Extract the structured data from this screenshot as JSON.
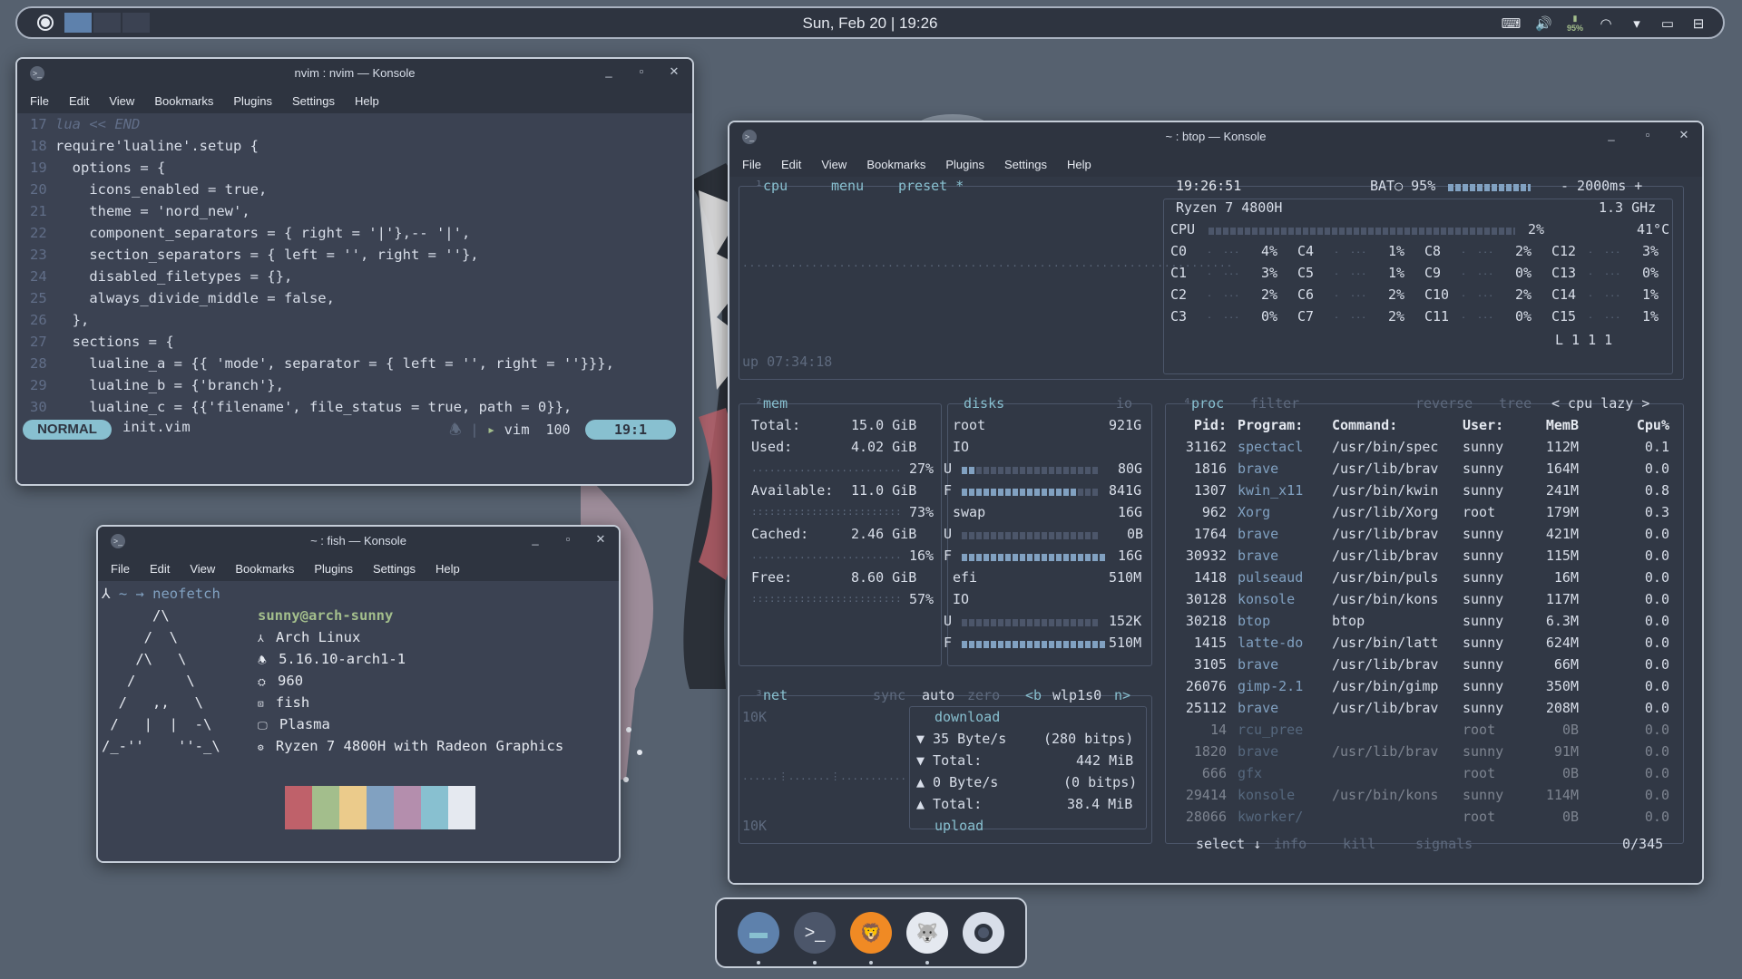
{
  "panel": {
    "datetime": "Sun, Feb 20 | 19:26",
    "battery": "95%",
    "icons": [
      "keyboard-icon",
      "volume-icon",
      "battery-icon",
      "wifi-icon",
      "chevron-down-icon",
      "display-icon",
      "window-icon"
    ]
  },
  "nvim": {
    "title": "nvim : nvim — Konsole",
    "menu": [
      "File",
      "Edit",
      "View",
      "Bookmarks",
      "Plugins",
      "Settings",
      "Help"
    ],
    "lines": [
      {
        "n": "17",
        "text": "lua << END"
      },
      {
        "n": "18",
        "text": "require'lualine'.setup {"
      },
      {
        "n": "19",
        "text": "  options = {"
      },
      {
        "n": "20",
        "text": "    icons_enabled = true,"
      },
      {
        "n": "21",
        "text": "    theme = 'nord_new',"
      },
      {
        "n": "22",
        "text": "    component_separators = { right = '|'},-- '|',"
      },
      {
        "n": "23",
        "text": "    section_separators = { left = '', right = ''},"
      },
      {
        "n": "24",
        "text": "    disabled_filetypes = {},"
      },
      {
        "n": "25",
        "text": "    always_divide_middle = false,"
      },
      {
        "n": "26",
        "text": "  },"
      },
      {
        "n": "27",
        "text": "  sections = {"
      },
      {
        "n": "28",
        "text": "    lualine_a = {{ 'mode', separator = { left = '', right = ''}}},"
      },
      {
        "n": "29",
        "text": "    lualine_b = {'branch'},"
      },
      {
        "n": "30",
        "text": "    lualine_c = {{'filename', file_status = true, path = 0}},"
      }
    ],
    "status": {
      "mode": "NORMAL",
      "file": "init.vim",
      "filetype": "vim",
      "percent": "100",
      "position": "19:1"
    }
  },
  "fish": {
    "title": "~ : fish — Konsole",
    "menu": [
      "File",
      "Edit",
      "View",
      "Bookmarks",
      "Plugins",
      "Settings",
      "Help"
    ],
    "prompt": "~ → neofetch",
    "user": "sunny@arch-sunny",
    "info": [
      "Arch Linux",
      "5.16.10-arch1-1",
      "960",
      "fish",
      "Plasma",
      "Ryzen 7 4800H with Radeon Graphics"
    ],
    "art": [
      "      /\\",
      "     /  \\",
      "    /\\   \\",
      "   /      \\",
      "  /   ,,   \\",
      " /   |  |  -\\",
      "/_-''    ''-_\\"
    ],
    "colors": [
      "#3b4252",
      "#bf616a",
      "#a3be8c",
      "#ebcb8b",
      "#81a1c1",
      "#b48ead",
      "#88c0d0",
      "#e5e9f0"
    ]
  },
  "btop": {
    "title": "~ : btop — Konsole",
    "menu": [
      "File",
      "Edit",
      "View",
      "Bookmarks",
      "Plugins",
      "Settings",
      "Help"
    ],
    "header": {
      "cpu": "cpu",
      "menu": "menu",
      "preset": "preset *",
      "time": "19:26:51",
      "bat": "BAT○ 95%",
      "interval": "- 2000ms +"
    },
    "cpu": {
      "model": "Ryzen 7 4800H",
      "freq": "1.3 GHz",
      "total_label": "CPU",
      "total": "2%",
      "temp": "41°C",
      "cores": [
        {
          "c": "C0",
          "v": "4%"
        },
        {
          "c": "C4",
          "v": "1%"
        },
        {
          "c": "C8",
          "v": "2%"
        },
        {
          "c": "C12",
          "v": "3%"
        },
        {
          "c": "C1",
          "v": "3%"
        },
        {
          "c": "C5",
          "v": "1%"
        },
        {
          "c": "C9",
          "v": "0%"
        },
        {
          "c": "C13",
          "v": "0%"
        },
        {
          "c": "C2",
          "v": "2%"
        },
        {
          "c": "C6",
          "v": "2%"
        },
        {
          "c": "C10",
          "v": "2%"
        },
        {
          "c": "C14",
          "v": "1%"
        },
        {
          "c": "C3",
          "v": "0%"
        },
        {
          "c": "C7",
          "v": "2%"
        },
        {
          "c": "C11",
          "v": "0%"
        },
        {
          "c": "C15",
          "v": "1%"
        }
      ],
      "load": "L 1 1 1",
      "uptime": "up 07:34:18"
    },
    "mem": {
      "title": "mem",
      "total": "Total:",
      "total_v": "15.0 GiB",
      "used": "Used:",
      "used_v": "4.02 GiB",
      "used_p": "27%",
      "avail": "Available:",
      "avail_v": "11.0 GiB",
      "avail_p": "73%",
      "cached": "Cached:",
      "cached_v": "2.46 GiB",
      "cached_p": "16%",
      "free": "Free:",
      "free_v": "8.60 GiB",
      "free_p": "57%"
    },
    "disks": {
      "title": "disks",
      "io": "io",
      "root": "root",
      "root_size": "921G",
      "io1": "IO",
      "u1": "U",
      "u1v": "80G",
      "f1": "F",
      "f1v": "841G",
      "swap": "swap",
      "swap_size": "16G",
      "u2": "U",
      "u2v": "0B",
      "f2": "F",
      "f2v": "16G",
      "efi": "efi",
      "efi_size": "510M",
      "io3": "IO",
      "u3": "U",
      "u3v": "152K",
      "f3": "F",
      "f3v": "510M",
      "usage": {
        "root_used": 0.09,
        "root_free": 0.91,
        "swap_used": 0.0,
        "swap_free": 1.0,
        "efi_used": 0.003,
        "efi_free": 1.0
      }
    },
    "net": {
      "title": "net",
      "sync": "sync",
      "auto": "auto",
      "zero": "zero",
      "iface_prev": "<b",
      "iface": "wlp1s0",
      "iface_next": "n>",
      "scale_top": "10K",
      "scale_bot": "10K",
      "download": "download",
      "dl_rate": "▼ 35 Byte/s",
      "dl_bits": "(280 bitps)",
      "dl_total_l": "▼ Total:",
      "dl_total": "442 MiB",
      "ul_rate": "▲ 0 Byte/s",
      "ul_bits": "(0 bitps)",
      "ul_total_l": "▲ Total:",
      "ul_total": "38.4 MiB",
      "upload": "upload"
    },
    "proc": {
      "title": "proc",
      "filter": "filter",
      "reverse": "reverse",
      "tree": "tree",
      "sort": "< cpu lazy >",
      "headers": [
        "Pid:",
        "Program:",
        "Command:",
        "User:",
        "MemB",
        "Cpu%"
      ],
      "rows": [
        [
          "31162",
          "spectacl",
          "/usr/bin/spec",
          "sunny",
          "112M",
          "0.1"
        ],
        [
          "1816",
          "brave",
          "/usr/lib/brav",
          "sunny",
          "164M",
          "0.0"
        ],
        [
          "1307",
          "kwin_x11",
          "/usr/bin/kwin",
          "sunny",
          "241M",
          "0.8"
        ],
        [
          "962",
          "Xorg",
          "/usr/lib/Xorg",
          "root",
          "179M",
          "0.3"
        ],
        [
          "1764",
          "brave",
          "/usr/lib/brav",
          "sunny",
          "421M",
          "0.0"
        ],
        [
          "30932",
          "brave",
          "/usr/lib/brav",
          "sunny",
          "115M",
          "0.0"
        ],
        [
          "1418",
          "pulseaud",
          "/usr/bin/puls",
          "sunny",
          "16M",
          "0.0"
        ],
        [
          "30128",
          "konsole",
          "/usr/bin/kons",
          "sunny",
          "117M",
          "0.0"
        ],
        [
          "30218",
          "btop",
          "btop",
          "sunny",
          "6.3M",
          "0.0"
        ],
        [
          "1415",
          "latte-do",
          "/usr/bin/latt",
          "sunny",
          "624M",
          "0.0"
        ],
        [
          "3105",
          "brave",
          "/usr/lib/brav",
          "sunny",
          "66M",
          "0.0"
        ],
        [
          "26076",
          "gimp-2.1",
          "/usr/bin/gimp",
          "sunny",
          "350M",
          "0.0"
        ],
        [
          "25112",
          "brave",
          "/usr/lib/brav",
          "sunny",
          "208M",
          "0.0"
        ],
        [
          "14",
          "rcu_pree",
          "",
          "root",
          "0B",
          "0.0"
        ],
        [
          "1820",
          "brave",
          "/usr/lib/brav",
          "sunny",
          "91M",
          "0.0"
        ],
        [
          "666",
          "gfx",
          "",
          "root",
          "0B",
          "0.0"
        ],
        [
          "29414",
          "konsole",
          "/usr/bin/kons",
          "sunny",
          "114M",
          "0.0"
        ],
        [
          "28066",
          "kworker/",
          "",
          "root",
          "0B",
          "0.0"
        ]
      ],
      "footer_select": "select ↓",
      "footer_info": "info",
      "footer_kill": "kill",
      "footer_signals": "signals",
      "count": "0/345"
    }
  },
  "dock": {
    "apps": [
      "files",
      "terminal",
      "brave",
      "gimp",
      "settings"
    ]
  }
}
